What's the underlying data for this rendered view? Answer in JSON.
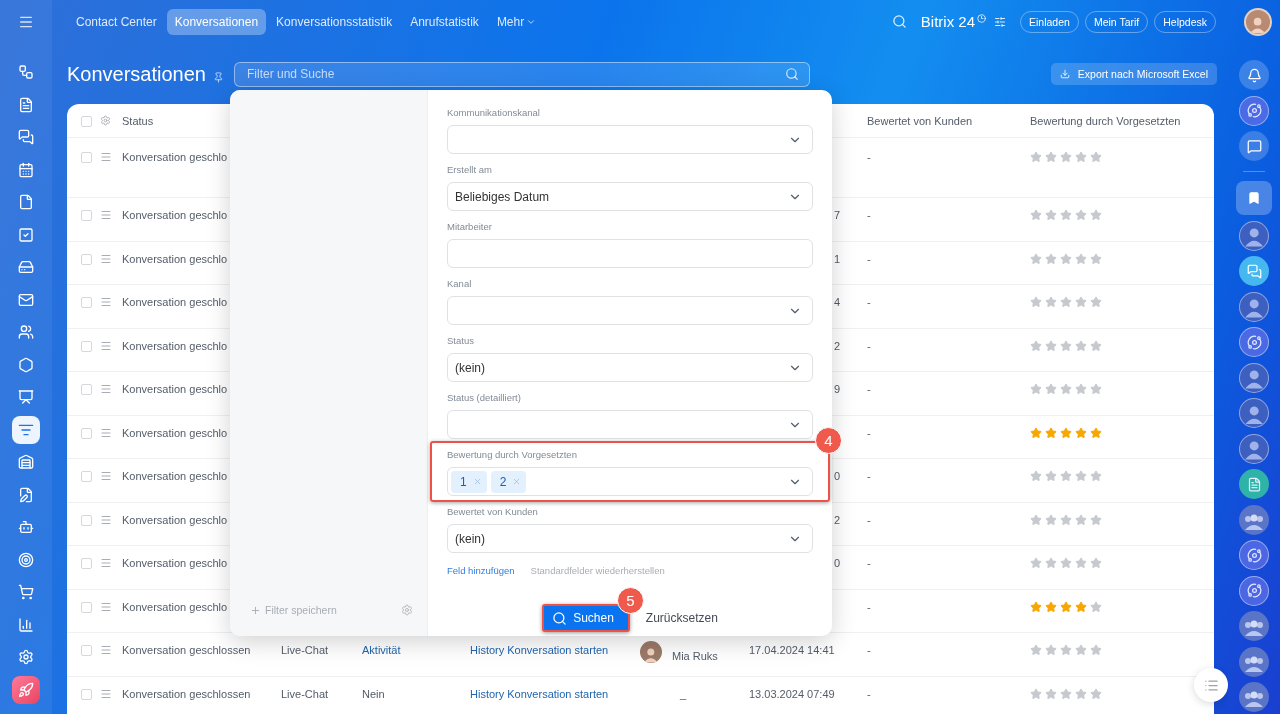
{
  "top_bar": {
    "tabs": [
      {
        "label": "Contact Center",
        "selected": false,
        "kind": "plain"
      },
      {
        "label": "Konversationen",
        "selected": true,
        "kind": "plain"
      },
      {
        "label": "Konversationsstatistik",
        "selected": false,
        "kind": "plain"
      },
      {
        "label": "Anrufstatistik",
        "selected": false,
        "kind": "plain"
      },
      {
        "label": "Mehr",
        "selected": false,
        "kind": "menu"
      }
    ],
    "logo": "Bitrix 24",
    "buttons": [
      "Einladen",
      "Mein Tarif",
      "Helpdesk"
    ]
  },
  "left_sidebar": {
    "items": [
      {
        "kind": "flow",
        "selected": false
      },
      {
        "kind": "document",
        "selected": false
      },
      {
        "kind": "chat",
        "selected": false
      },
      {
        "kind": "calendar",
        "selected": false
      },
      {
        "kind": "file",
        "selected": false
      },
      {
        "kind": "task",
        "selected": false
      },
      {
        "kind": "drive",
        "selected": false
      },
      {
        "kind": "mail",
        "selected": false
      },
      {
        "kind": "people",
        "selected": false
      },
      {
        "kind": "hexagon",
        "selected": false
      },
      {
        "kind": "board",
        "selected": false
      },
      {
        "kind": "filter",
        "selected": true
      },
      {
        "kind": "warehouse",
        "selected": false
      },
      {
        "kind": "sign",
        "selected": false
      },
      {
        "kind": "bot",
        "selected": false
      },
      {
        "kind": "target",
        "selected": false
      },
      {
        "kind": "cart",
        "selected": false
      },
      {
        "kind": "chart",
        "selected": false
      },
      {
        "kind": "settings",
        "selected": false
      },
      {
        "kind": "rocket",
        "selected": false
      }
    ]
  },
  "page": {
    "title": "Konversationen",
    "search": {
      "placeholder": "Filter und Suche"
    },
    "export_button": "Export nach Microsoft Excel"
  },
  "table": {
    "select_all": {
      "checked": false
    },
    "columns": [
      {
        "label": "Status"
      },
      {
        "label": "Bewertet von Kunden"
      },
      {
        "label": "Bewertung durch Vorgesetzten"
      }
    ],
    "rows": [
      {
        "checked": false,
        "status": "Konversation geschlo",
        "rated_by_customer": "-",
        "stars": 0
      },
      {
        "checked": false,
        "status": "Konversation geschlo",
        "date": "7",
        "rated_by_customer": "-",
        "stars": 0
      },
      {
        "checked": false,
        "status": "Konversation geschlo",
        "date": "1",
        "rated_by_customer": "-",
        "stars": 0
      },
      {
        "checked": false,
        "status": "Konversation geschlo",
        "date": "4",
        "rated_by_customer": "-",
        "stars": 0
      },
      {
        "checked": false,
        "status": "Konversation geschlo",
        "date": "2",
        "rated_by_customer": "-",
        "stars": 0
      },
      {
        "checked": false,
        "status": "Konversation geschlo",
        "date": "9",
        "rated_by_customer": "-",
        "stars": 0
      },
      {
        "checked": false,
        "status": "Konversation geschlo",
        "rated_by_customer": "-",
        "stars": 5
      },
      {
        "checked": false,
        "status": "Konversation geschlo",
        "date": "0",
        "rated_by_customer": "-",
        "stars": 0
      },
      {
        "checked": false,
        "status": "Konversation geschlo",
        "date": "2",
        "rated_by_customer": "-",
        "stars": 0
      },
      {
        "checked": false,
        "status": "Konversation geschlo",
        "date": "0",
        "rated_by_customer": "-",
        "stars": 0
      },
      {
        "checked": false,
        "status": "Konversation geschlo",
        "rated_by_customer": "-",
        "stars": 4
      },
      {
        "checked": false,
        "status": "Konversation geschlossen",
        "channel": "Live-Chat",
        "column_3": {
          "text": "Aktivität",
          "kind": "link"
        },
        "column_4": "History Konversation starten",
        "operator": {
          "name": "Mia Ruks",
          "has_avatar": true
        },
        "date": "17.04.2024 14:41",
        "rated_by_customer": "-",
        "stars": 0
      },
      {
        "checked": false,
        "status": "Konversation geschlossen",
        "channel": "Live-Chat",
        "column_3": {
          "text": "Nein",
          "kind": "plain"
        },
        "column_4": "History Konversation starten",
        "operator": {
          "name": "_",
          "has_avatar": false
        },
        "date": "13.03.2024 07:49",
        "rated_by_customer": "-",
        "stars": 0
      }
    ]
  },
  "filter_popup": {
    "save_filter": "Filter speichern",
    "fields": [
      {
        "label": "Kommunikationskanal",
        "kind": "select"
      },
      {
        "label": "Erstellt am",
        "kind": "select",
        "value": "Beliebiges Datum"
      },
      {
        "label": "Mitarbeiter",
        "kind": "input"
      },
      {
        "label": "Kanal",
        "kind": "select"
      },
      {
        "label": "Status",
        "kind": "select",
        "value": "(kein)"
      },
      {
        "label": "Status (detailliert)",
        "kind": "select"
      },
      {
        "label": "Bewertung durch Vorgesetzten",
        "kind": "tags",
        "tags": [
          "1",
          "2"
        ],
        "highlighted": true,
        "callout": "4"
      },
      {
        "label": "Bewertet von Kunden",
        "kind": "select",
        "value": "(kein)"
      }
    ],
    "add_field_link": "Feld hinzufügen",
    "restore_link": "Standardfelder wiederherstellen",
    "search_button": {
      "label": "Suchen",
      "highlighted": true,
      "callout": "5"
    },
    "reset_button": "Zurücksetzen"
  },
  "right_sidebar": {
    "items": [
      {
        "kind": "bell",
        "selected": false
      },
      {
        "kind": "orbit",
        "selected": false
      },
      {
        "kind": "chat",
        "selected": false
      },
      {
        "kind": "bookmark",
        "selected": true
      },
      {
        "kind": "avatar",
        "selected": false
      },
      {
        "kind": "bubble",
        "selected": false
      },
      {
        "kind": "avatar",
        "selected": false
      },
      {
        "kind": "orbit",
        "selected": false
      },
      {
        "kind": "avatar",
        "selected": false
      },
      {
        "kind": "avatar",
        "selected": false
      },
      {
        "kind": "avatar",
        "selected": false
      },
      {
        "kind": "document",
        "selected": false
      },
      {
        "kind": "group",
        "selected": false
      },
      {
        "kind": "orbit",
        "selected": false
      },
      {
        "kind": "orbit",
        "selected": false
      },
      {
        "kind": "group",
        "selected": false
      },
      {
        "kind": "group",
        "selected": false
      },
      {
        "kind": "group",
        "selected": false
      }
    ]
  }
}
